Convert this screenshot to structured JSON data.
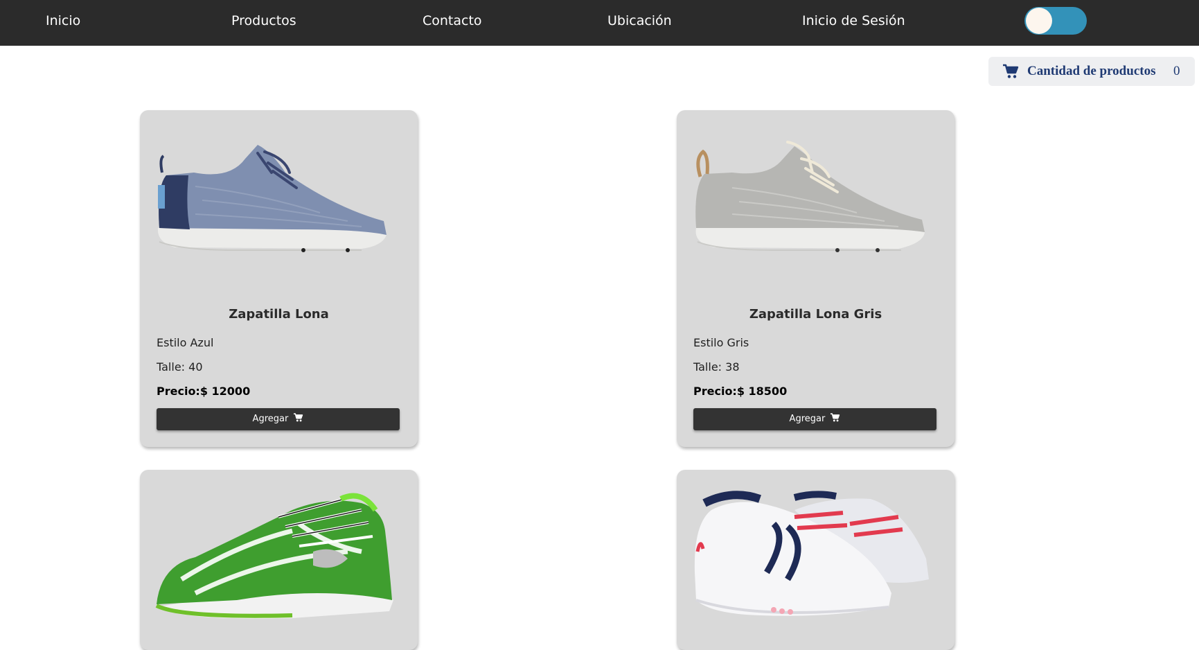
{
  "nav": {
    "links": [
      "Inicio",
      "Productos",
      "Contacto",
      "Ubicación",
      "Inicio de Sesión"
    ],
    "theme_toggle": {
      "on": true
    }
  },
  "cart": {
    "icon": "shopping-cart-icon",
    "label": "Cantidad de productos",
    "count": "0"
  },
  "colors": {
    "nav_bg": "#2b2b2b",
    "toggle_on": "#3392b9",
    "card_bg": "#d9d9d9",
    "button_bg": "#333333",
    "cart_text": "#1f3a73"
  },
  "products": [
    {
      "title": "Zapatilla Lona",
      "style": "Estilo Azul",
      "size": "Talle: 40",
      "price": "Precio:$ 12000",
      "button": "Agregar",
      "image": "blue-canvas-sneaker"
    },
    {
      "title": "Zapatilla Lona Gris",
      "style": "Estilo Gris",
      "size": "Talle: 38",
      "price": "Precio:$ 18500",
      "button": "Agregar",
      "image": "grey-canvas-sneaker"
    },
    {
      "image": "green-running-shoe"
    },
    {
      "image": "white-navy-tennis-shoes"
    }
  ]
}
